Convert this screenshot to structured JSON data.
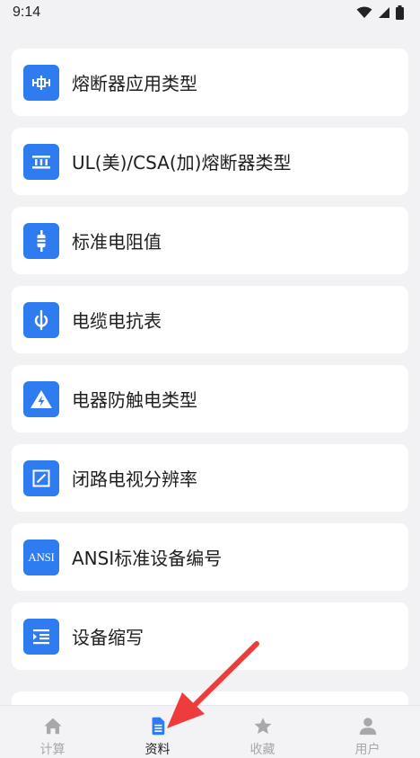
{
  "status_bar": {
    "time": "9:14"
  },
  "menu_items": [
    {
      "label": "熔断器应用类型",
      "icon": "fuse-icon"
    },
    {
      "label": "UL(美)/CSA(加)熔断器类型",
      "icon": "fuse-block-icon"
    },
    {
      "label": "标准电阻值",
      "icon": "resistor-icon"
    },
    {
      "label": "电缆电抗表",
      "icon": "cable-reactance-icon"
    },
    {
      "label": "电器防触电类型",
      "icon": "electric-shock-warning-icon"
    },
    {
      "label": "闭路电视分辨率",
      "icon": "cctv-resolution-icon"
    },
    {
      "label": "ANSI标准设备编号",
      "icon": "ansi-icon",
      "icon_text": "ANSI"
    },
    {
      "label": "设备缩写",
      "icon": "list-indent-icon"
    }
  ],
  "tab_bar": {
    "tabs": [
      {
        "label": "计算",
        "icon": "home-icon",
        "active": false
      },
      {
        "label": "资料",
        "icon": "document-icon",
        "active": true
      },
      {
        "label": "收藏",
        "icon": "star-icon",
        "active": false
      },
      {
        "label": "用户",
        "icon": "user-icon",
        "active": false
      }
    ]
  },
  "colors": {
    "accent": "#2f7bf0",
    "background": "#f2f2f4",
    "card": "#ffffff",
    "annotation_arrow": "#ee3b3b",
    "tab_inactive": "#a8a8ac"
  }
}
